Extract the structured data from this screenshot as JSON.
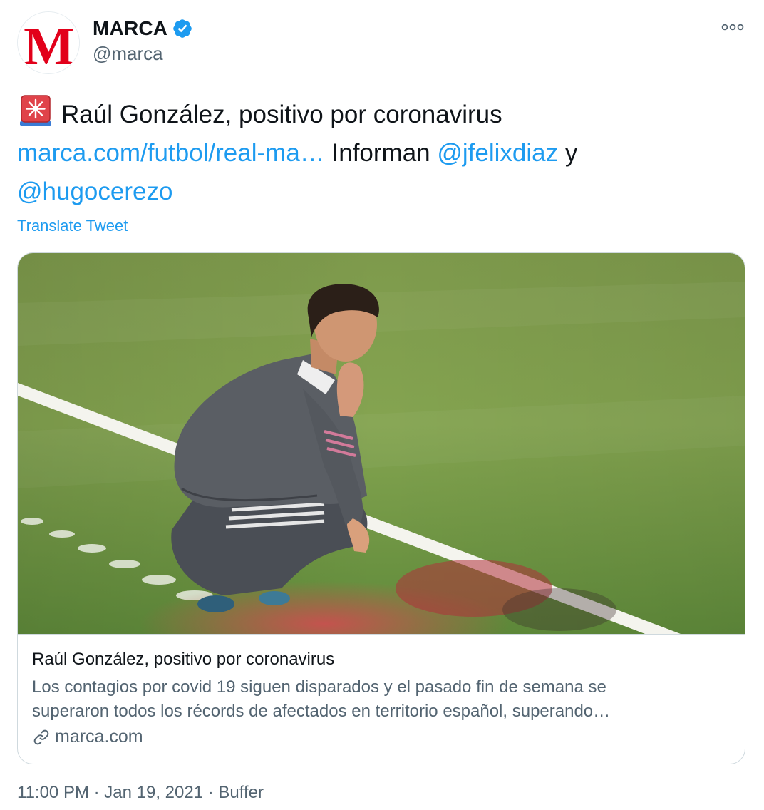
{
  "author": {
    "display_name": "MARCA",
    "handle": "@marca",
    "avatar_letter": "M",
    "verified": true,
    "avatar_color": "#e2001a"
  },
  "tweet": {
    "headline": "Raúl González, positivo por coronavirus",
    "link_text": "marca.com/futbol/real-ma…",
    "text_informan": " Informan ",
    "mention_1": "@jfelixdiaz",
    "text_y": " y",
    "mention_2": "@hugocerezo",
    "translate_label": "Translate Tweet",
    "link_color": "#1d9bf0"
  },
  "card": {
    "title": "Raúl González, positivo por coronavirus",
    "description_line_1": "Los contagios por covid 19 siguen disparados y el pasado fin de semana se",
    "description_line_2": "superaron todos los récords de afectados en territorio español, superando…",
    "domain": "marca.com"
  },
  "footer": {
    "time": "11:00 PM",
    "separator_1": " · ",
    "date": "Jan 19, 2021",
    "separator_2": " · ",
    "source": "Buffer"
  },
  "icons": {
    "verified": "verified-badge-icon",
    "more": "more-options-icon",
    "siren": "rotating-light-emoji",
    "link": "link-icon"
  }
}
